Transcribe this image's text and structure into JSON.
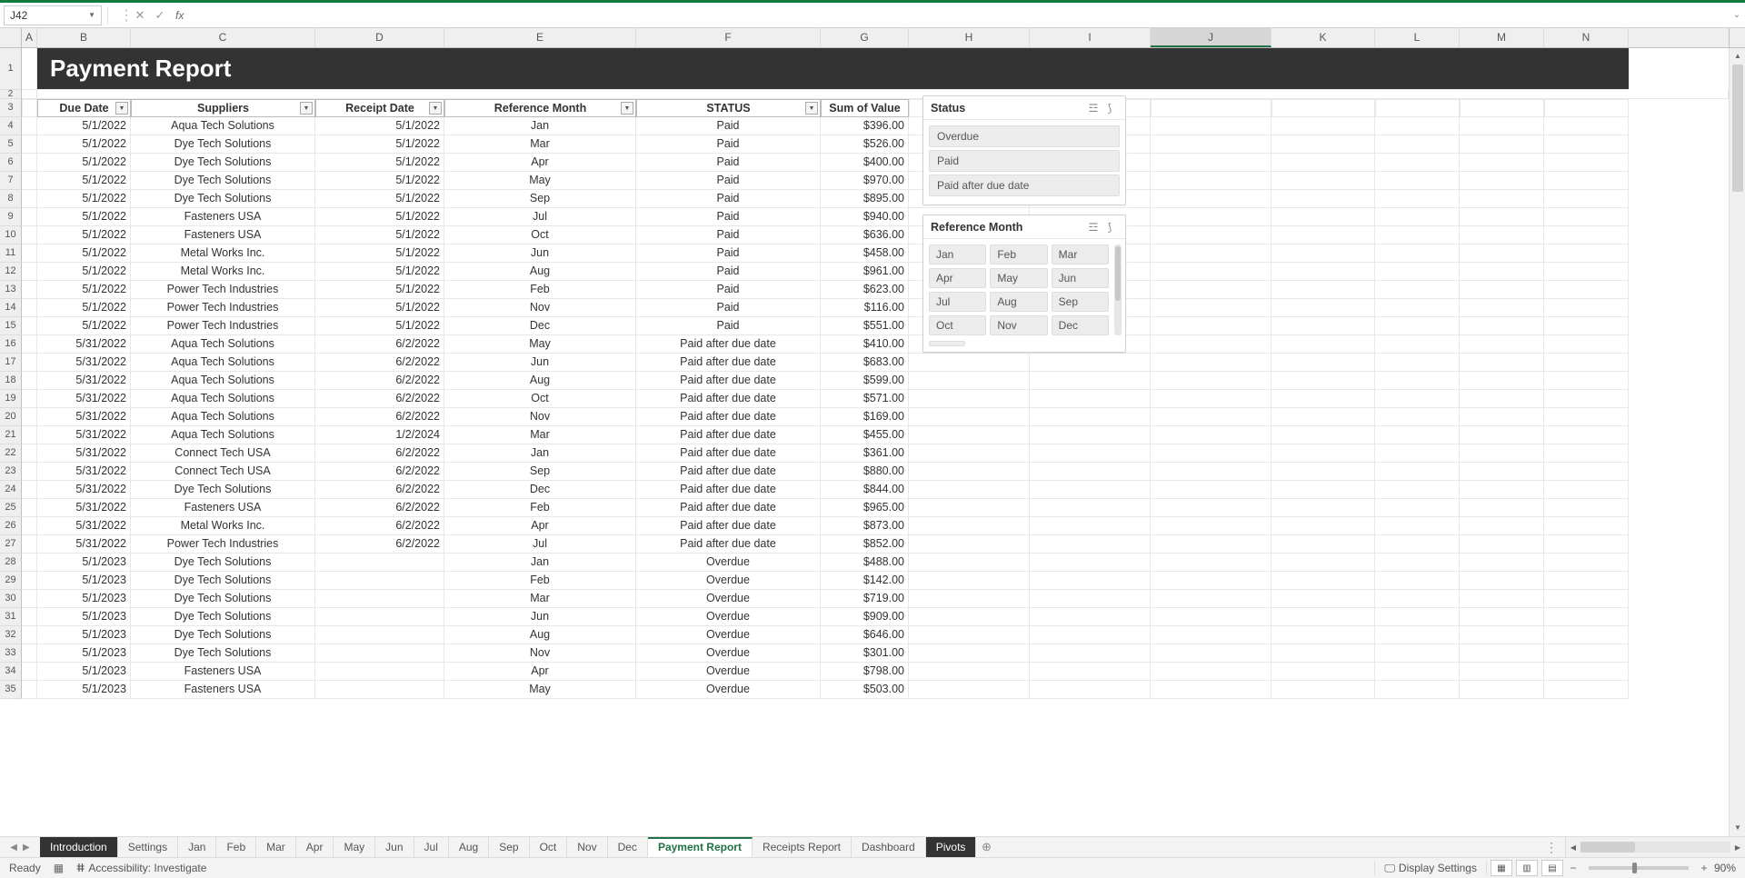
{
  "nameBox": "J42",
  "fxLabel": "fx",
  "titleCell": "Payment Report",
  "columnLetters": [
    "A",
    "B",
    "C",
    "D",
    "E",
    "F",
    "G",
    "H",
    "I",
    "J",
    "K",
    "L",
    "M",
    "N"
  ],
  "activeColIndex": 9,
  "headers": [
    "Due Date",
    "Suppliers",
    "Receipt Date",
    "Reference Month",
    "STATUS",
    "Sum of Value"
  ],
  "rows": [
    {
      "n": 4,
      "due": "5/1/2022",
      "sup": "Aqua Tech Solutions",
      "rec": "5/1/2022",
      "ref": "Jan",
      "st": "Paid",
      "val": "$396.00"
    },
    {
      "n": 5,
      "due": "5/1/2022",
      "sup": "Dye Tech Solutions",
      "rec": "5/1/2022",
      "ref": "Mar",
      "st": "Paid",
      "val": "$526.00"
    },
    {
      "n": 6,
      "due": "5/1/2022",
      "sup": "Dye Tech Solutions",
      "rec": "5/1/2022",
      "ref": "Apr",
      "st": "Paid",
      "val": "$400.00"
    },
    {
      "n": 7,
      "due": "5/1/2022",
      "sup": "Dye Tech Solutions",
      "rec": "5/1/2022",
      "ref": "May",
      "st": "Paid",
      "val": "$970.00"
    },
    {
      "n": 8,
      "due": "5/1/2022",
      "sup": "Dye Tech Solutions",
      "rec": "5/1/2022",
      "ref": "Sep",
      "st": "Paid",
      "val": "$895.00"
    },
    {
      "n": 9,
      "due": "5/1/2022",
      "sup": "Fasteners USA",
      "rec": "5/1/2022",
      "ref": "Jul",
      "st": "Paid",
      "val": "$940.00"
    },
    {
      "n": 10,
      "due": "5/1/2022",
      "sup": "Fasteners USA",
      "rec": "5/1/2022",
      "ref": "Oct",
      "st": "Paid",
      "val": "$636.00"
    },
    {
      "n": 11,
      "due": "5/1/2022",
      "sup": "Metal Works Inc.",
      "rec": "5/1/2022",
      "ref": "Jun",
      "st": "Paid",
      "val": "$458.00"
    },
    {
      "n": 12,
      "due": "5/1/2022",
      "sup": "Metal Works Inc.",
      "rec": "5/1/2022",
      "ref": "Aug",
      "st": "Paid",
      "val": "$961.00"
    },
    {
      "n": 13,
      "due": "5/1/2022",
      "sup": "Power Tech Industries",
      "rec": "5/1/2022",
      "ref": "Feb",
      "st": "Paid",
      "val": "$623.00"
    },
    {
      "n": 14,
      "due": "5/1/2022",
      "sup": "Power Tech Industries",
      "rec": "5/1/2022",
      "ref": "Nov",
      "st": "Paid",
      "val": "$116.00"
    },
    {
      "n": 15,
      "due": "5/1/2022",
      "sup": "Power Tech Industries",
      "rec": "5/1/2022",
      "ref": "Dec",
      "st": "Paid",
      "val": "$551.00"
    },
    {
      "n": 16,
      "due": "5/31/2022",
      "sup": "Aqua Tech Solutions",
      "rec": "6/2/2022",
      "ref": "May",
      "st": "Paid after due date",
      "val": "$410.00"
    },
    {
      "n": 17,
      "due": "5/31/2022",
      "sup": "Aqua Tech Solutions",
      "rec": "6/2/2022",
      "ref": "Jun",
      "st": "Paid after due date",
      "val": "$683.00"
    },
    {
      "n": 18,
      "due": "5/31/2022",
      "sup": "Aqua Tech Solutions",
      "rec": "6/2/2022",
      "ref": "Aug",
      "st": "Paid after due date",
      "val": "$599.00"
    },
    {
      "n": 19,
      "due": "5/31/2022",
      "sup": "Aqua Tech Solutions",
      "rec": "6/2/2022",
      "ref": "Oct",
      "st": "Paid after due date",
      "val": "$571.00"
    },
    {
      "n": 20,
      "due": "5/31/2022",
      "sup": "Aqua Tech Solutions",
      "rec": "6/2/2022",
      "ref": "Nov",
      "st": "Paid after due date",
      "val": "$169.00"
    },
    {
      "n": 21,
      "due": "5/31/2022",
      "sup": "Aqua Tech Solutions",
      "rec": "1/2/2024",
      "ref": "Mar",
      "st": "Paid after due date",
      "val": "$455.00"
    },
    {
      "n": 22,
      "due": "5/31/2022",
      "sup": "Connect Tech USA",
      "rec": "6/2/2022",
      "ref": "Jan",
      "st": "Paid after due date",
      "val": "$361.00"
    },
    {
      "n": 23,
      "due": "5/31/2022",
      "sup": "Connect Tech USA",
      "rec": "6/2/2022",
      "ref": "Sep",
      "st": "Paid after due date",
      "val": "$880.00"
    },
    {
      "n": 24,
      "due": "5/31/2022",
      "sup": "Dye Tech Solutions",
      "rec": "6/2/2022",
      "ref": "Dec",
      "st": "Paid after due date",
      "val": "$844.00"
    },
    {
      "n": 25,
      "due": "5/31/2022",
      "sup": "Fasteners USA",
      "rec": "6/2/2022",
      "ref": "Feb",
      "st": "Paid after due date",
      "val": "$965.00"
    },
    {
      "n": 26,
      "due": "5/31/2022",
      "sup": "Metal Works Inc.",
      "rec": "6/2/2022",
      "ref": "Apr",
      "st": "Paid after due date",
      "val": "$873.00"
    },
    {
      "n": 27,
      "due": "5/31/2022",
      "sup": "Power Tech Industries",
      "rec": "6/2/2022",
      "ref": "Jul",
      "st": "Paid after due date",
      "val": "$852.00"
    },
    {
      "n": 28,
      "due": "5/1/2023",
      "sup": "Dye Tech Solutions",
      "rec": "",
      "ref": "Jan",
      "st": "Overdue",
      "val": "$488.00"
    },
    {
      "n": 29,
      "due": "5/1/2023",
      "sup": "Dye Tech Solutions",
      "rec": "",
      "ref": "Feb",
      "st": "Overdue",
      "val": "$142.00"
    },
    {
      "n": 30,
      "due": "5/1/2023",
      "sup": "Dye Tech Solutions",
      "rec": "",
      "ref": "Mar",
      "st": "Overdue",
      "val": "$719.00"
    },
    {
      "n": 31,
      "due": "5/1/2023",
      "sup": "Dye Tech Solutions",
      "rec": "",
      "ref": "Jun",
      "st": "Overdue",
      "val": "$909.00"
    },
    {
      "n": 32,
      "due": "5/1/2023",
      "sup": "Dye Tech Solutions",
      "rec": "",
      "ref": "Aug",
      "st": "Overdue",
      "val": "$646.00"
    },
    {
      "n": 33,
      "due": "5/1/2023",
      "sup": "Dye Tech Solutions",
      "rec": "",
      "ref": "Nov",
      "st": "Overdue",
      "val": "$301.00"
    },
    {
      "n": 34,
      "due": "5/1/2023",
      "sup": "Fasteners USA",
      "rec": "",
      "ref": "Apr",
      "st": "Overdue",
      "val": "$798.00"
    },
    {
      "n": 35,
      "due": "5/1/2023",
      "sup": "Fasteners USA",
      "rec": "",
      "ref": "May",
      "st": "Overdue",
      "val": "$503.00"
    }
  ],
  "slicerStatus": {
    "title": "Status",
    "items": [
      "Overdue",
      "Paid",
      "Paid after due date"
    ]
  },
  "slicerMonth": {
    "title": "Reference Month",
    "items": [
      "Jan",
      "Feb",
      "Mar",
      "Apr",
      "May",
      "Jun",
      "Jul",
      "Aug",
      "Sep",
      "Oct",
      "Nov",
      "Dec"
    ]
  },
  "sheetTabs": [
    {
      "label": "Introduction",
      "style": "dark"
    },
    {
      "label": "Settings",
      "style": ""
    },
    {
      "label": "Jan",
      "style": ""
    },
    {
      "label": "Feb",
      "style": ""
    },
    {
      "label": "Mar",
      "style": ""
    },
    {
      "label": "Apr",
      "style": ""
    },
    {
      "label": "May",
      "style": ""
    },
    {
      "label": "Jun",
      "style": ""
    },
    {
      "label": "Jul",
      "style": ""
    },
    {
      "label": "Aug",
      "style": ""
    },
    {
      "label": "Sep",
      "style": ""
    },
    {
      "label": "Oct",
      "style": ""
    },
    {
      "label": "Nov",
      "style": ""
    },
    {
      "label": "Dec",
      "style": ""
    },
    {
      "label": "Payment Report",
      "style": "active"
    },
    {
      "label": "Receipts Report",
      "style": ""
    },
    {
      "label": "Dashboard",
      "style": ""
    },
    {
      "label": "Pivots",
      "style": "dark"
    }
  ],
  "status": {
    "ready": "Ready",
    "accessibility": "Accessibility: Investigate",
    "displaySettings": "Display Settings",
    "zoom": "90%"
  }
}
